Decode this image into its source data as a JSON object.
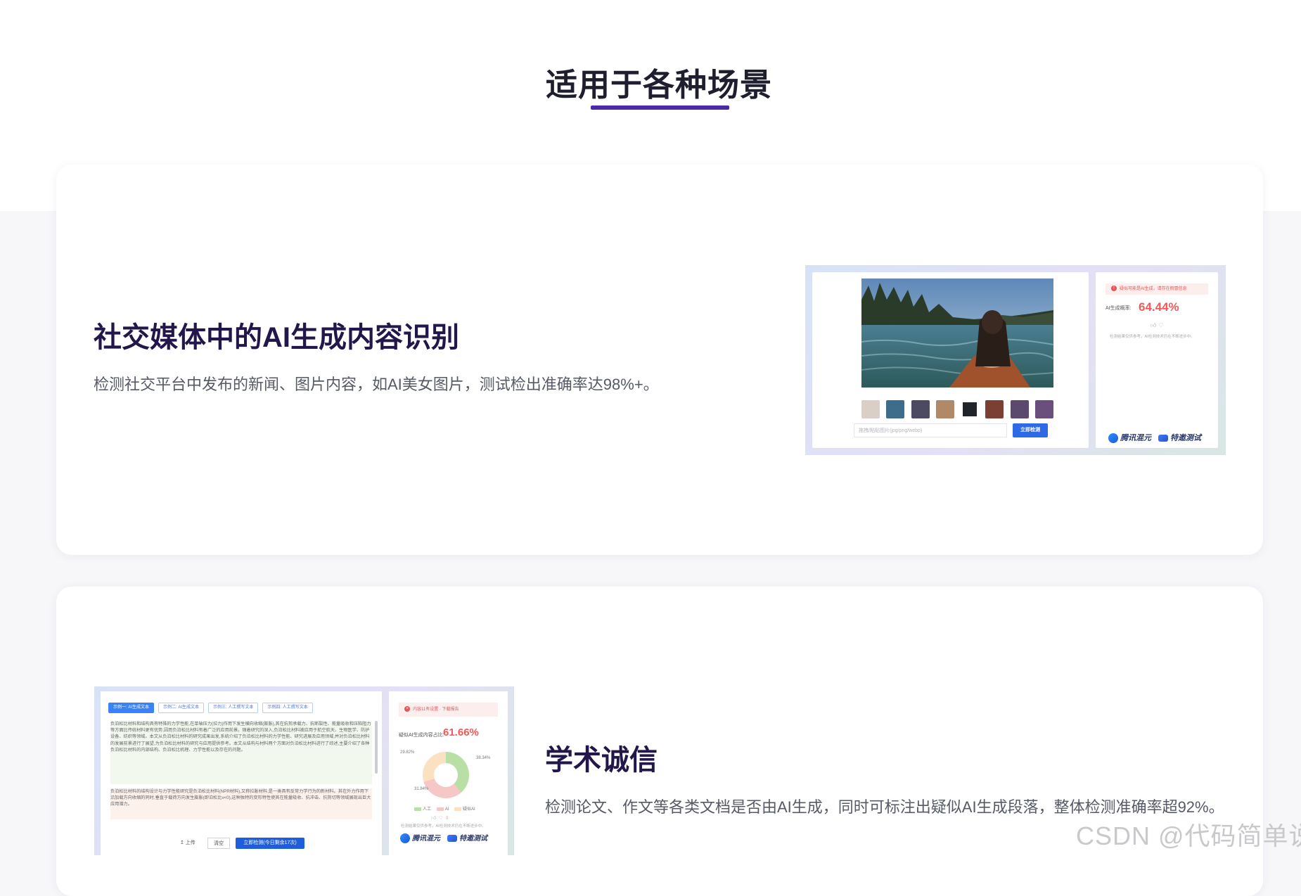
{
  "section": {
    "title": "适用于各种场景"
  },
  "feature1": {
    "title": "社交媒体中的AI生成内容识别",
    "desc": "检测社交平台中发布的新闻、图片内容，如AI美女图片，测试检出准确率达98%+。",
    "mock": {
      "input_placeholder": "拖拽/粘贴图片(jpg/png/webp)",
      "detect_button": "立即检测",
      "warning": "疑似可能是AI生成，请存在假冒信息",
      "rate_label": "AI生成概率:",
      "rate_value": "64.44%",
      "note": "检测结果仅供参考，AI检测技术仍在不断进步中。",
      "logo1": "腾讯混元",
      "logo2": "特邀测试",
      "thumb_colors": [
        "#d9cfc6",
        "#3e6d8c",
        "#4b4a62",
        "#b08a68",
        "#20242b",
        "#7b3f34",
        "#5b4a6e",
        "#6a4f7c"
      ]
    }
  },
  "feature2": {
    "title": "学术诚信",
    "desc": "检测论文、作文等各类文档是否由AI生成，同时可标注出疑似AI生成段落，整体检测准确率超92%。",
    "mock": {
      "tabs": [
        "示例一: AI生成文本",
        "示例二: AI生成文本",
        "示例三: 人工撰写文本",
        "示例四: 人工撰写文本"
      ],
      "para1": "负泊松比材料和结构具有特殊的力学性能,在单轴压力(拉力)作用下发生横向收缩(膨胀),其在抗剪承载力、抗断裂性、能量吸收和压陷阻力等方面比传统材料更有优势,因而负泊松比材料有着广泛的应用前景。随着研究的深入,负泊松比材料被应用于航空航天、生物医学、防护设备、纺织等领域。本文从负泊松比材料的研究成果出发,系统介绍了负泊松比材料的力学性能、研究进展及应用领域,并对负泊松比材料的发展前景进行了展望,为负泊松比材料的研究与应用提供参考。本文从结构与材料两个方面对负泊松比材料进行了综述,主要介绍了各种负泊松比材料的内部结构、负泊松比机理、力学性能以及存在的问题。",
      "para2": "负泊松比材料的结构设计与力学性能研究是负泊松比材料(NPR材料),又称拉胀材料,是一类具有反常力学行为的新材料。其在外力作用下沿加载方向收缩的同时,垂直于载荷方向发生膨胀(即泊松比v<0),这种独特的变形特性使其在能量吸收、抗冲击、抗剪切等领域展现出巨大应用潜力。",
      "upload_label": "↥ 上传",
      "clear_label": "清空",
      "detect_button": "立即检测(今日剩余17次)",
      "warning": "内容11有设置 · 下载报告",
      "rate_label": "疑似AI生成内容占比:",
      "rate_value": "61.66%",
      "pct_left": "29.82%",
      "pct_right": "38.34%",
      "pct_bottom": "31.84%",
      "legend": [
        "人工",
        "AI",
        "疑似AI"
      ],
      "note": "检测结果仅供参考，AI检测技术仍在不断进步中。",
      "logo1": "腾讯混元",
      "logo2": "特邀测试"
    }
  },
  "watermark": "CSDN @代码简单说"
}
